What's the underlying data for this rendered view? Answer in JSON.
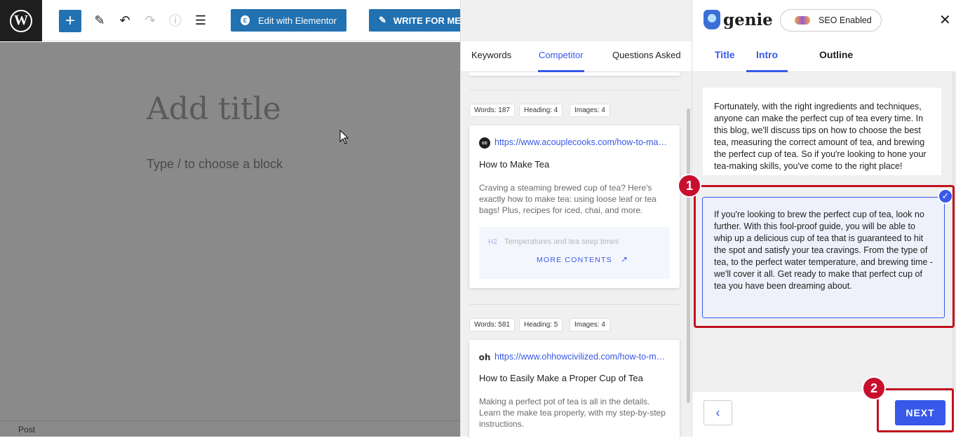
{
  "toolbar": {
    "edit_elementor": "Edit with Elementor",
    "write_for_me": "WRITE FOR ME"
  },
  "editor": {
    "title_placeholder": "Add title",
    "block_placeholder": "Type / to choose a block",
    "status": "Post"
  },
  "mid_panel": {
    "tabs": [
      "Keywords",
      "Competitor",
      "Questions Asked"
    ],
    "active_tab": "Competitor",
    "results": [
      {
        "words": "Words: 187",
        "headings": "Heading: 4",
        "images": "Images: 4",
        "favicon": "cc",
        "url": "https://www.acouplecooks.com/how-to-make-tea/",
        "title": "How to Make Tea",
        "description": "Craving a steaming brewed cup of tea? Here's exactly how to make tea: using loose leaf or tea bags! Plus, recipes for iced, chai, and more.",
        "h2_label": "H2",
        "h2_text": "Temperatures and tea seep times",
        "more": "MORE CONTENTS"
      },
      {
        "words": "Words: 581",
        "headings": "Heading: 5",
        "images": "Images: 4",
        "favicon": "oh",
        "url": "https://www.ohhowcivilized.com/how-to-make-tea/",
        "title": "How to Easily Make a Proper Cup of Tea",
        "description": "Making a perfect pot of tea is all in the details. Learn the make tea properly, with my step-by-step instructions."
      }
    ]
  },
  "genie": {
    "brand": "genie",
    "seo_status": "SEO Enabled",
    "tabs": [
      "Title",
      "Intro",
      "Outline"
    ],
    "active_tab": "Intro",
    "intro_option_1": "Fortunately, with the right ingredients and techniques, anyone can make the perfect cup of tea every time. In this blog, we'll discuss tips on how to choose the best tea, measuring the correct amount of tea, and brewing the perfect cup of tea. So if you're looking to hone your tea-making skills, you've come to the right place!",
    "intro_option_2": "If you're looking to brew the perfect cup of tea, look no further. With this fool-proof guide, you will be able to whip up a delicious cup of tea that is guaranteed to hit the spot and satisfy your tea cravings. From the type of tea, to the perfect water temperature, and brewing time - we'll cover it all. Get ready to make that perfect cup of tea you have been dreaming about.",
    "next_label": "NEXT"
  },
  "annotations": {
    "badge_1": "1",
    "badge_2": "2"
  },
  "icons": [
    "wordpress-icon",
    "plus-icon",
    "pen-icon",
    "undo-icon",
    "redo-icon",
    "info-icon",
    "list-view-icon",
    "elementor-icon",
    "pencil-icon",
    "close-icon",
    "check-icon",
    "chevron-left-icon",
    "external-arrow-icon"
  ],
  "colors": {
    "accent": "#3858e9",
    "wp_blue": "#2271b1",
    "annotation_red": "#c1121f"
  }
}
